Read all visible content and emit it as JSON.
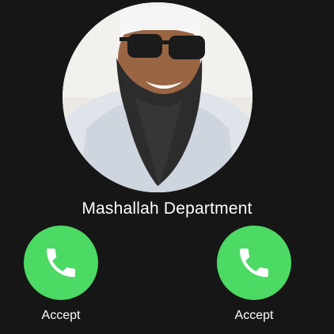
{
  "caller": {
    "name": "Mashallah Department"
  },
  "actions": {
    "left": {
      "label": "Accept",
      "icon": "phone-icon",
      "color": "#4cd964"
    },
    "right": {
      "label": "Accept",
      "icon": "phone-icon",
      "color": "#4cd964"
    }
  },
  "colors": {
    "background": "#161616",
    "accept_green": "#4cd964",
    "text": "#ffffff"
  }
}
